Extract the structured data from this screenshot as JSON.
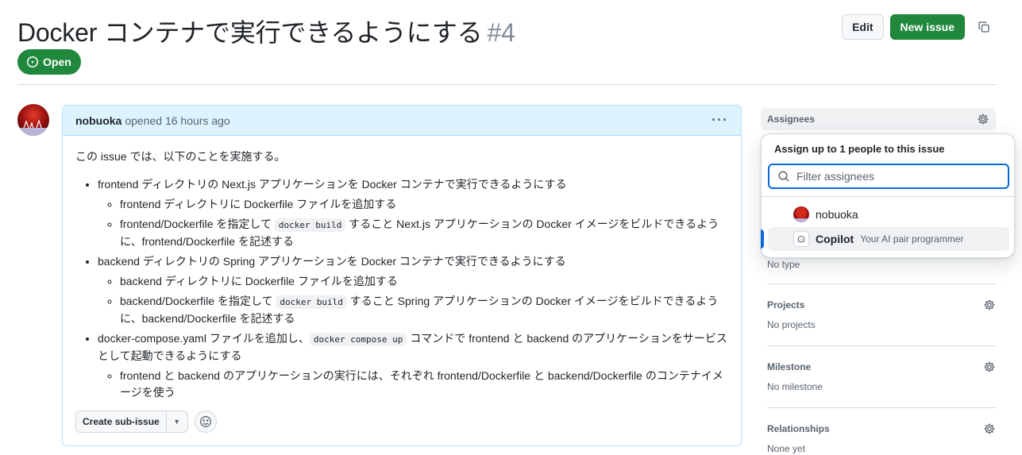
{
  "issue": {
    "title": "Docker コンテナで実行できるようにする",
    "number": "#4",
    "state": "Open"
  },
  "header_actions": {
    "edit_label": "Edit",
    "new_issue_label": "New issue"
  },
  "comment": {
    "author": "nobuoka",
    "meta": "opened 16 hours ago",
    "intro": "この issue では、以下のことを実施する。",
    "items": [
      {
        "text": "frontend ディレクトリの Next.js アプリケーションを Docker コンテナで実行できるようにする",
        "sub": [
          {
            "text": "frontend ディレクトリに Dockerfile ファイルを追加する"
          },
          {
            "pre": "frontend/Dockerfile を指定して ",
            "code": "docker build",
            "post": " すること Next.js アプリケーションの Docker イメージをビルドできるように、frontend/Dockerfile を記述する"
          }
        ]
      },
      {
        "text": "backend ディレクトリの Spring アプリケーションを Docker コンテナで実行できるようにする",
        "sub": [
          {
            "text": "backend ディレクトリに Dockerfile ファイルを追加する"
          },
          {
            "pre": "backend/Dockerfile を指定して ",
            "code": "docker build",
            "post": " すること Spring アプリケーションの Docker イメージをビルドできるように、backend/Dockerfile を記述する"
          }
        ]
      },
      {
        "pre": "docker-compose.yaml ファイルを追加し、",
        "code": "docker compose up",
        "post": " コマンドで frontend と backend のアプリケーションをサービスとして起動できるようにする",
        "sub": [
          {
            "text": "frontend と backend のアプリケーションの実行には、それぞれ frontend/Dockerfile と backend/Dockerfile のコンテナイメージを使う"
          }
        ]
      }
    ],
    "create_sub_issue_label": "Create sub-issue"
  },
  "sidebar": {
    "assignees_label": "Assignees",
    "type_value": "No type",
    "projects_label": "Projects",
    "projects_value": "No projects",
    "milestone_label": "Milestone",
    "milestone_value": "No milestone",
    "relationships_label": "Relationships",
    "relationships_value": "None yet"
  },
  "assignee_overlay": {
    "title": "Assign up to 1 people to this issue",
    "filter_placeholder": "Filter assignees",
    "options": [
      {
        "name": "nobuoka",
        "desc": ""
      },
      {
        "name": "Copilot",
        "desc": "Your AI pair programmer"
      }
    ]
  },
  "colors": {
    "open_green": "#1f883d",
    "accent_blue": "#0969da",
    "comment_header_bg": "#ddf4ff"
  }
}
